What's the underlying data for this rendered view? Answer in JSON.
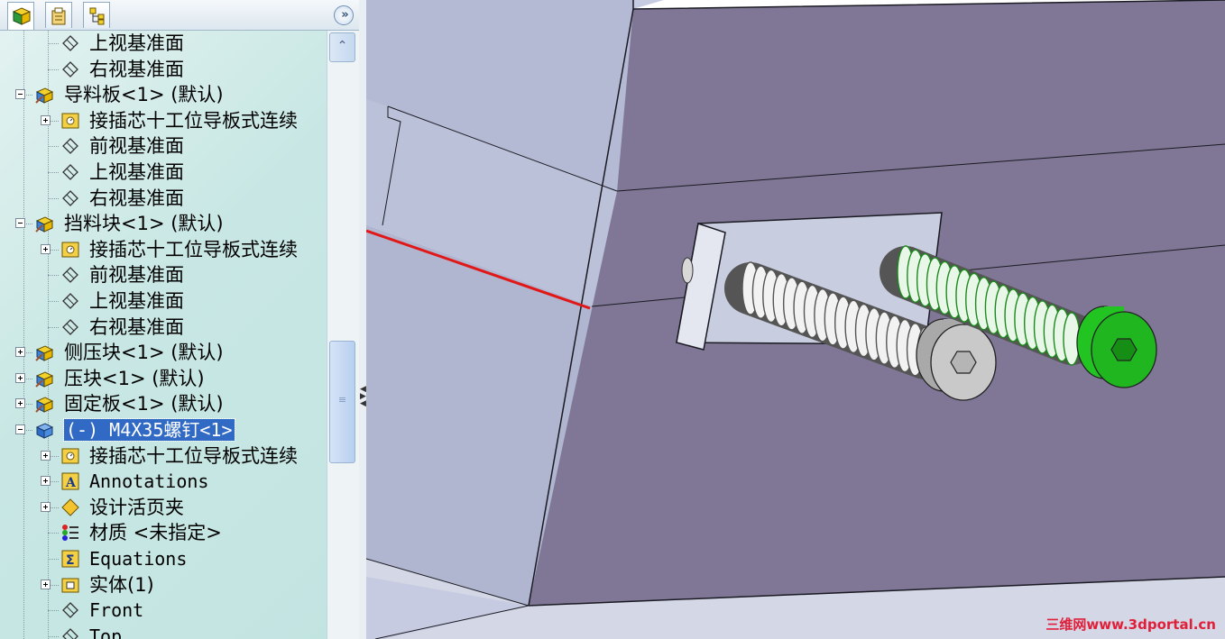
{
  "panel": {
    "tabs": [
      {
        "name": "featuremanager-tab",
        "icon": "feature-tree-icon"
      },
      {
        "name": "propertymanager-tab",
        "icon": "property-manager-icon"
      },
      {
        "name": "configurationmanager-tab",
        "icon": "configuration-manager-icon"
      }
    ],
    "collapse_glyph": "»"
  },
  "tree": {
    "rows": [
      {
        "label": "上视基准面",
        "icon": "plane-icon",
        "indent": 2,
        "expander": null
      },
      {
        "label": "右视基准面",
        "icon": "plane-icon",
        "indent": 2,
        "expander": null
      },
      {
        "label": "导料板<1> (默认)",
        "icon": "part-icon",
        "indent": 1,
        "expander": "minus"
      },
      {
        "label": "接插芯十工位导板式连续",
        "icon": "history-folder-icon",
        "indent": 2,
        "expander": "plus"
      },
      {
        "label": "前视基准面",
        "icon": "plane-icon",
        "indent": 2,
        "expander": null
      },
      {
        "label": "上视基准面",
        "icon": "plane-icon",
        "indent": 2,
        "expander": null
      },
      {
        "label": "右视基准面",
        "icon": "plane-icon",
        "indent": 2,
        "expander": null
      },
      {
        "label": "挡料块<1> (默认)",
        "icon": "part-icon",
        "indent": 1,
        "expander": "minus"
      },
      {
        "label": "接插芯十工位导板式连续",
        "icon": "history-folder-icon",
        "indent": 2,
        "expander": "plus"
      },
      {
        "label": "前视基准面",
        "icon": "plane-icon",
        "indent": 2,
        "expander": null
      },
      {
        "label": "上视基准面",
        "icon": "plane-icon",
        "indent": 2,
        "expander": null
      },
      {
        "label": "右视基准面",
        "icon": "plane-icon",
        "indent": 2,
        "expander": null
      },
      {
        "label": "侧压块<1> (默认)",
        "icon": "part-icon",
        "indent": 1,
        "expander": "plus"
      },
      {
        "label": "压块<1> (默认)",
        "icon": "part-icon",
        "indent": 1,
        "expander": "plus"
      },
      {
        "label": "固定板<1> (默认)",
        "icon": "part-icon",
        "indent": 1,
        "expander": "plus"
      },
      {
        "label": "(-) M4X35螺钉<1>",
        "icon": "part-blue-icon",
        "indent": 1,
        "expander": "minus",
        "selected": true
      },
      {
        "label": "接插芯十工位导板式连续",
        "icon": "history-folder-icon",
        "indent": 2,
        "expander": "plus"
      },
      {
        "label": "Annotations",
        "icon": "annotations-icon",
        "indent": 2,
        "expander": "plus"
      },
      {
        "label": "设计活页夹",
        "icon": "design-binder-icon",
        "indent": 2,
        "expander": "plus"
      },
      {
        "label": "材质 <未指定>",
        "icon": "material-icon",
        "indent": 2,
        "expander": null
      },
      {
        "label": "Equations",
        "icon": "equations-icon",
        "indent": 2,
        "expander": null
      },
      {
        "label": "实体(1)",
        "icon": "solid-bodies-folder-icon",
        "indent": 2,
        "expander": "plus"
      },
      {
        "label": "Front",
        "icon": "plane-icon",
        "indent": 2,
        "expander": null
      },
      {
        "label": "Top",
        "icon": "plane-icon",
        "indent": 2,
        "expander": null
      }
    ]
  },
  "scrollbar": {
    "up_glyph": "⌃",
    "thumb_grip": "≡"
  },
  "viewport": {
    "watermark": "三维网www.3dportal.cn",
    "colors": {
      "face_front": "#7f7795",
      "face_side": "#b0b6d0",
      "face_top": "#c6cbe1",
      "edge": "#1a1a22",
      "red_line": "#e01818",
      "screw_gray": "#c9c9c9",
      "screw_green": "#22c422"
    }
  }
}
